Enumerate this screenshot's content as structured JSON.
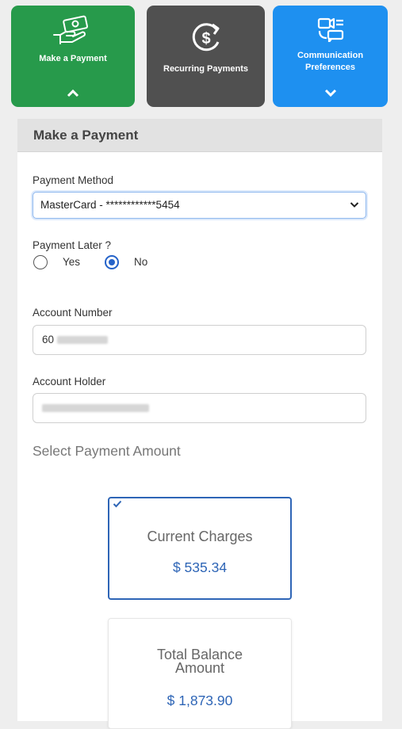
{
  "tiles": [
    {
      "label": "Make a Payment",
      "icon": "hand-money-icon",
      "chevron": "chevron-up",
      "color": "#279a4b"
    },
    {
      "label": "Recurring Payments",
      "icon": "recurring-dollar-icon",
      "color": "#505050"
    },
    {
      "label_line1": "Communication",
      "label_line2": "Preferences",
      "icon": "chat-icon",
      "chevron": "chevron-down",
      "color": "#1e90f0"
    }
  ],
  "section": {
    "title": "Make a Payment"
  },
  "payment_method": {
    "label": "Payment Method",
    "value": "MasterCard - ************5454"
  },
  "payment_later": {
    "label": "Payment Later ?",
    "options": [
      "Yes",
      "No"
    ],
    "selected": "No"
  },
  "account_number": {
    "label": "Account Number",
    "value_visible": "60"
  },
  "account_holder": {
    "label": "Account Holder"
  },
  "amount_section": {
    "title": "Select Payment Amount"
  },
  "amount_options": [
    {
      "title": "Current Charges",
      "value": "$ 535.34",
      "selected": true
    },
    {
      "title_line1": "Total Balance",
      "title_line2": "Amount",
      "value": "$ 1,873.90",
      "selected": false
    }
  ],
  "colors": {
    "accent_blue": "#2e65b6",
    "green": "#279a4b",
    "dark": "#505050",
    "blue": "#1e90f0"
  }
}
